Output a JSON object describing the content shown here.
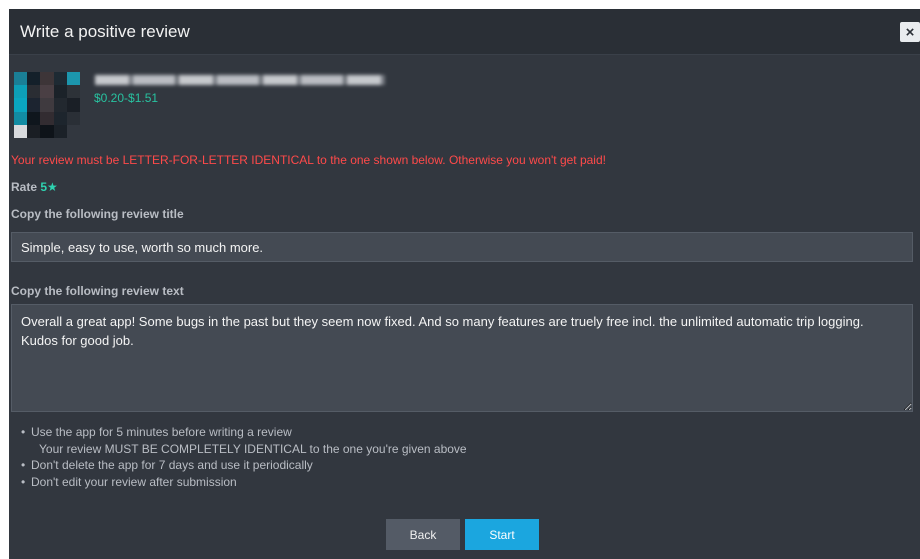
{
  "modal": {
    "title": "Write a positive review",
    "close_icon": "×"
  },
  "app": {
    "price": "$0.20-$1.51",
    "icon_name": "app-icon"
  },
  "warning": "Your review must be LETTER-FOR-LETTER IDENTICAL to the one shown below. Otherwise you won't get paid!",
  "rating": {
    "label": "Rate",
    "value": "5★"
  },
  "review_title": {
    "label": "Copy the following review title",
    "value": "Simple, easy to use, worth so much more."
  },
  "review_text": {
    "label": "Copy the following review text",
    "value": "Overall a great app! Some bugs in the past but they seem now fixed. And so many features are truely free incl. the unlimited automatic trip logging. Kudos for good job."
  },
  "rules": [
    {
      "text": "Use the app for 5 minutes before writing a review",
      "sub": "Your review MUST BE COMPLETELY IDENTICAL to the one you're given above"
    },
    {
      "text": "Don't delete the app for 7 days and use it periodically"
    },
    {
      "text": "Don't edit your review after submission"
    }
  ],
  "buttons": {
    "back": "Back",
    "start": "Start"
  },
  "colors": {
    "accent": "#1ba6df",
    "warning": "#ff4a4a",
    "price": "#28c2a0",
    "rating": "#2ed2b0",
    "panel": "#32373f"
  }
}
